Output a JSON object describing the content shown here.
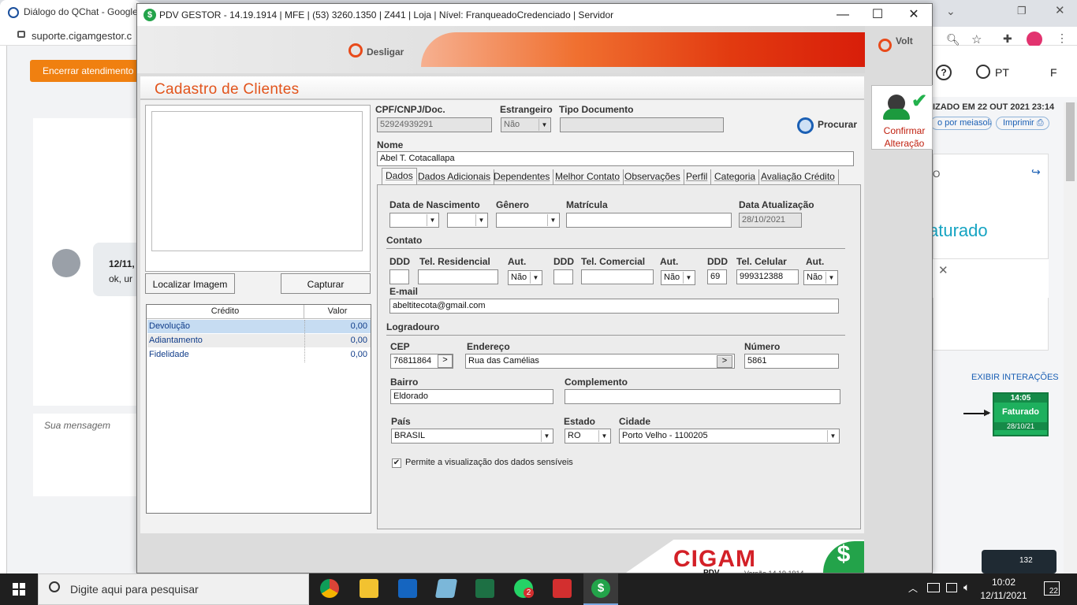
{
  "browser": {
    "tab_title": "Diálogo do QChat - Google",
    "url": "suporte.cigamgestor.c",
    "end_button": "Encerrar atendimento",
    "chat_time": "12/11,",
    "chat_text": "ok, ur",
    "message_placeholder": "Sua mensagem",
    "right_status": "IZADO EM 22 OUT 2021 23:14",
    "right_link": "o por meiasola",
    "right_print": "Imprimir",
    "right_lang": "PT",
    "right_user": "F",
    "faturado_big": "aturado",
    "exibir": "EXIBIR INTERAÇÕES",
    "card_faturado": "Faturado",
    "card_time": "14:05",
    "card_date": "28/10/21",
    "card_short": "O",
    "notif_count": "132"
  },
  "window": {
    "title": "PDV GESTOR - 14.19.1914  |  MFE  |  (53) 3260.1350  |  Z441  |  Loja  |  Nível: FranqueadoCredenciado  |  Servidor",
    "app_icon": "$",
    "minimize": "—",
    "maximize": "☐",
    "close": "✕"
  },
  "toolbar": {
    "desligar": "Desligar",
    "voltar": "Volt",
    "confirmar": "Confirmar Alteração"
  },
  "form": {
    "title": "Cadastro de Clientes",
    "localizar": "Localizar Imagem",
    "capturar": "Capturar",
    "credit_headers": [
      "Crédito",
      "Valor"
    ],
    "credits": [
      {
        "name": "Devolução",
        "value": "0,00"
      },
      {
        "name": "Adiantamento",
        "value": "0,00"
      },
      {
        "name": "Fidelidade",
        "value": "0,00"
      }
    ],
    "cpf_label": "CPF/CNPJ/Doc.",
    "cpf_value": "52924939291",
    "estrangeiro_label": "Estrangeiro",
    "estrangeiro_value": "Não",
    "tipo_doc_label": "Tipo Documento",
    "tipo_doc_value": "",
    "procurar": "Procurar",
    "nome_label": "Nome",
    "nome_value": "Abel T. Cotacallapa",
    "tabs": [
      "Dados",
      "Dados Adicionais",
      "Dependentes",
      "Melhor Contato",
      "Observações",
      "Perfil",
      "Categoria",
      "Avaliação Crédito"
    ],
    "data_nasc_label": "Data de Nascimento",
    "genero_label": "Gênero",
    "matricula_label": "Matrícula",
    "data_atual_label": "Data Atualização",
    "data_atual_value": "28/10/2021",
    "contato_label": "Contato",
    "ddd_label": "DDD",
    "tel_res_label": "Tel. Residencial",
    "aut_label": "Aut.",
    "tel_com_label": "Tel. Comercial",
    "tel_cel_label": "Tel. Celular",
    "aut_res": "Não",
    "aut_com": "Não",
    "aut_cel": "Não",
    "ddd_cel": "69",
    "tel_cel": "999312388",
    "email_label": "E-mail",
    "email_value": "abeltitecota@gmail.com",
    "logradouro_label": "Logradouro",
    "cep_label": "CEP",
    "cep_value": "76811864",
    "cep_btn": ">",
    "endereco_label": "Endereço",
    "endereco_value": "Rua das Camélias",
    "end_btn": ">",
    "numero_label": "Número",
    "numero_value": "5861",
    "bairro_label": "Bairro",
    "bairro_value": "Eldorado",
    "complemento_label": "Complemento",
    "complemento_value": "",
    "pais_label": "País",
    "pais_value": "BRASIL",
    "estado_label": "Estado",
    "estado_value": "RO",
    "cidade_label": "Cidade",
    "cidade_value": "Porto Velho - 1100205",
    "sensiveis_label": "Permite a visualização dos dados sensíveis",
    "sensiveis_checked": "✔"
  },
  "branding": {
    "logo": "CIGAM",
    "version": "Versão 14.19.1914",
    "pdv": "PDV",
    "dollar": "$"
  },
  "taskbar": {
    "search": "Digite aqui para pesquisar",
    "time": "10:02",
    "date": "12/11/2021",
    "notifications": "22",
    "whatsapp_badge": "2"
  }
}
